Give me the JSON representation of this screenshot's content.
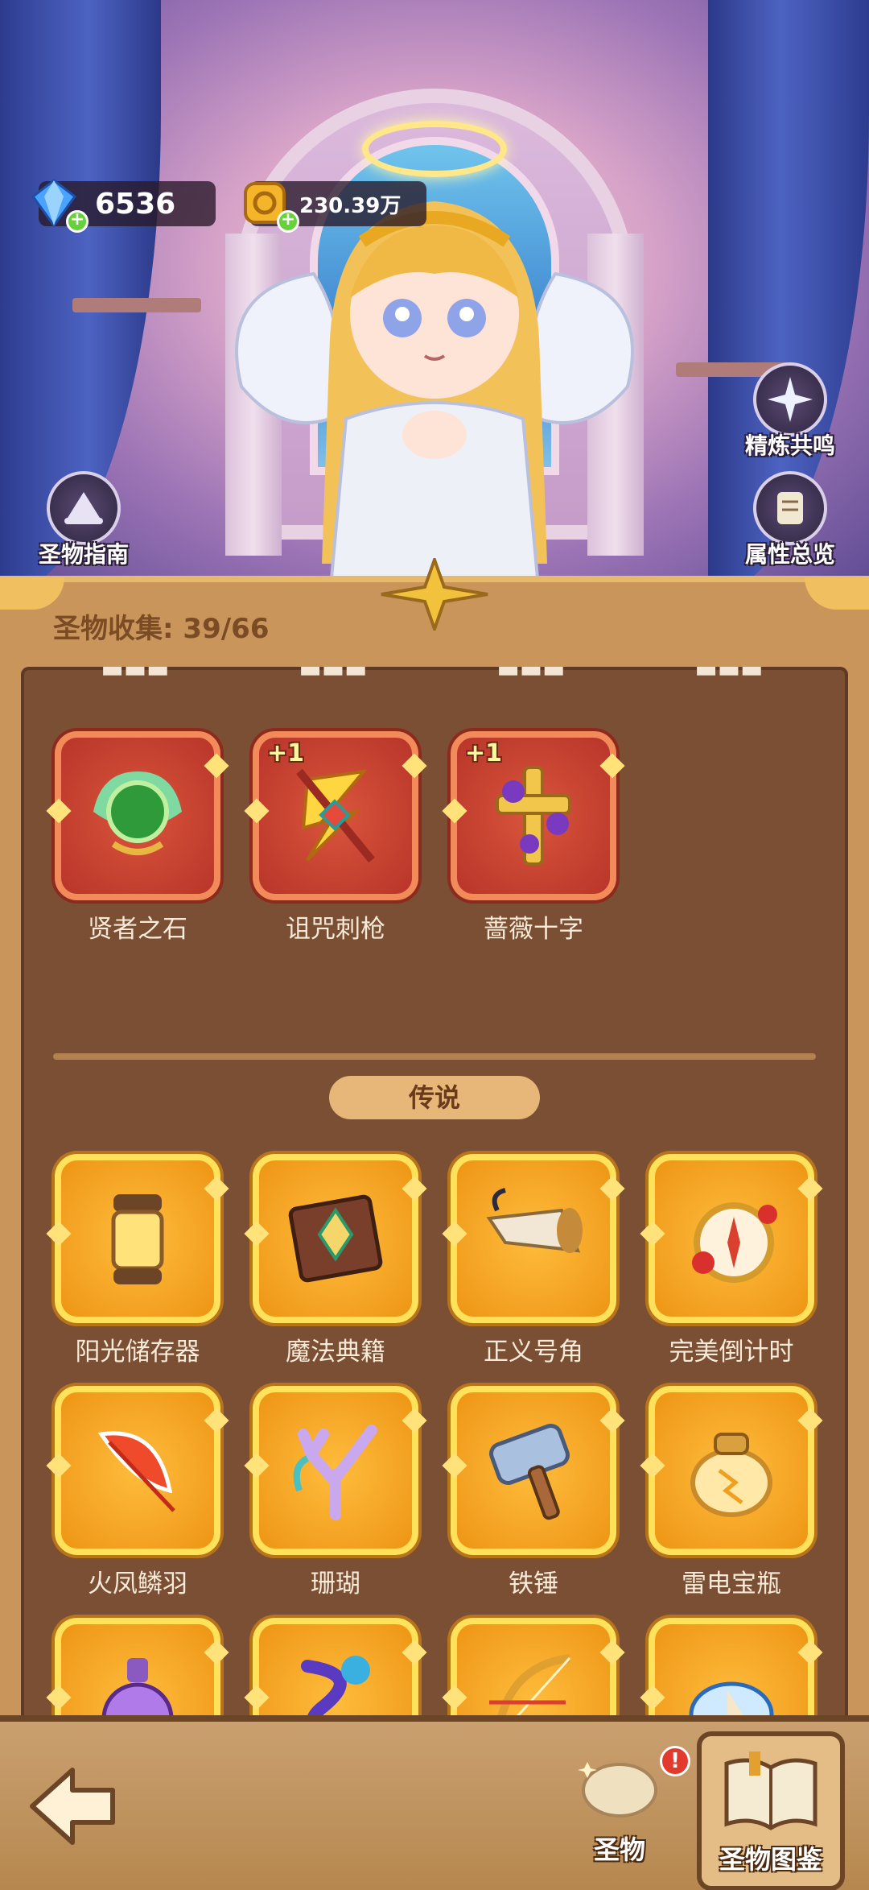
{
  "currency": {
    "gems": "6536",
    "gold": "230.39万"
  },
  "side_buttons": {
    "guide": "圣物指南",
    "refine": "精炼共鸣",
    "attributes": "属性总览"
  },
  "collection": {
    "label": "圣物收集: 39/66"
  },
  "epic_items": [
    {
      "name": "贤者之石",
      "badge": ""
    },
    {
      "name": "诅咒刺枪",
      "badge": "+1"
    },
    {
      "name": "蔷薇十字",
      "badge": "+1"
    }
  ],
  "section": {
    "legend_label": "传说"
  },
  "legend_items": [
    {
      "name": "阳光储存器"
    },
    {
      "name": "魔法典籍"
    },
    {
      "name": "正义号角"
    },
    {
      "name": "完美倒计时"
    },
    {
      "name": "火凤鳞羽"
    },
    {
      "name": "珊瑚"
    },
    {
      "name": "铁锤"
    },
    {
      "name": "雷电宝瓶"
    },
    {
      "name": ""
    },
    {
      "name": ""
    },
    {
      "name": ""
    },
    {
      "name": ""
    }
  ],
  "bottom_tabs": {
    "relic": "圣物",
    "codex": "圣物图鉴",
    "alert": "!"
  },
  "colors": {
    "red_frame": "#f28a59",
    "gold_frame": "#ffe15a",
    "panel": "#7b4f33"
  }
}
